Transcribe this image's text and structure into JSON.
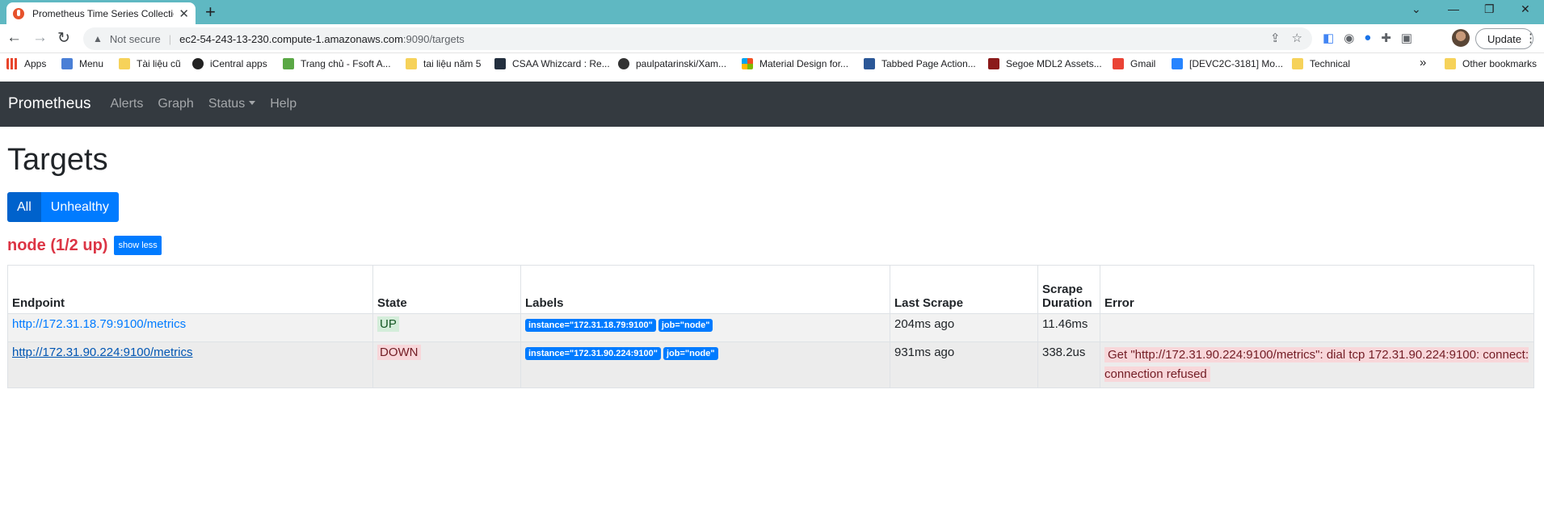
{
  "browser": {
    "tab_title": "Prometheus Time Series Collection",
    "tab_close": "✕",
    "new_tab": "+",
    "url_warning": "Not secure",
    "url_host": "ec2-54-243-13-230.compute-1.amazonaws.com",
    "url_path": ":9090/targets",
    "update_label": "Update",
    "win_controls": [
      "⌄",
      "—",
      "❐",
      "✕"
    ],
    "bookmarks": [
      {
        "label": "Apps",
        "icon": "apps-grid-icon"
      },
      {
        "label": "Menu",
        "icon": "menu-icon"
      },
      {
        "label": "Tài liệu cũ",
        "icon": "folder-icon"
      },
      {
        "label": "iCentral apps",
        "icon": "icentral-icon"
      },
      {
        "label": "Trang chủ - Fsoft A...",
        "icon": "fsoft-icon"
      },
      {
        "label": "tai liệu năm 5",
        "icon": "folder-icon"
      },
      {
        "label": "CSAA Whizcard : Re...",
        "icon": "aws-icon"
      },
      {
        "label": "paulpatarinski/Xam...",
        "icon": "github-icon"
      },
      {
        "label": "Material Design for...",
        "icon": "microsoft-icon"
      },
      {
        "label": "Tabbed Page Action...",
        "icon": "tabbed-icon"
      },
      {
        "label": "Segoe MDL2 Assets...",
        "icon": "segoe-icon"
      },
      {
        "label": "Gmail",
        "icon": "gmail-icon"
      },
      {
        "label": "[DEVC2C-3181] Mo...",
        "icon": "jira-icon"
      },
      {
        "label": "Technical",
        "icon": "folder-icon"
      },
      {
        "label": "»",
        "icon": ""
      },
      {
        "label": "Other bookmarks",
        "icon": "folder-icon"
      }
    ]
  },
  "nav": {
    "brand": "Prometheus",
    "links": [
      "Alerts",
      "Graph",
      "Status",
      "Help"
    ]
  },
  "page": {
    "title": "Targets",
    "filters": [
      "All",
      "Unhealthy"
    ],
    "job_title": "node (1/2 up)",
    "show_less": "show less"
  },
  "table": {
    "headers": [
      "Endpoint",
      "State",
      "Labels",
      "Last Scrape",
      "Scrape Duration",
      "Error"
    ],
    "rows": [
      {
        "endpoint": "http://172.31.18.79:9100/metrics",
        "state": "UP",
        "labels": [
          "instance=\"172.31.18.79:9100\"",
          "job=\"node\""
        ],
        "last_scrape": "204ms ago",
        "duration": "11.46ms",
        "error": ""
      },
      {
        "endpoint": "http://172.31.90.224:9100/metrics",
        "state": "DOWN",
        "labels": [
          "instance=\"172.31.90.224:9100\"",
          "job=\"node\""
        ],
        "last_scrape": "931ms ago",
        "duration": "338.2us",
        "error": "Get \"http://172.31.90.224:9100/metrics\": dial tcp 172.31.90.224:9100: connect: connection refused"
      }
    ]
  },
  "colors": {
    "titlebar": "#5fb8c2",
    "navbar": "#343a40",
    "primary": "#007bff",
    "danger": "#dc3545"
  }
}
